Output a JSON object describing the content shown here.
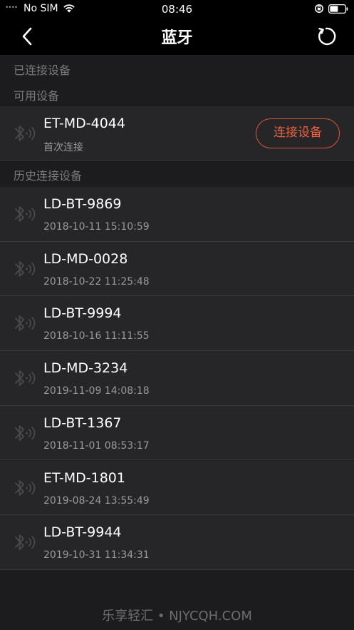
{
  "status_bar": {
    "signal": "••••",
    "carrier": "No SIM",
    "time": "08:46"
  },
  "nav": {
    "title": "蓝牙"
  },
  "sections": {
    "connected": "已连接设备",
    "available": "可用设备",
    "history": "历史连接设备"
  },
  "available_devices": [
    {
      "name": "ET-MD-4044",
      "sub": "首次连接",
      "action": "连接设备"
    }
  ],
  "history_devices": [
    {
      "name": "LD-BT-9869",
      "time": "2018-10-11 15:10:59"
    },
    {
      "name": "LD-MD-0028",
      "time": "2018-10-22 11:25:48"
    },
    {
      "name": "LD-BT-9994",
      "time": "2018-10-16 11:11:55"
    },
    {
      "name": "LD-MD-3234",
      "time": "2019-11-09 14:08:18"
    },
    {
      "name": "LD-BT-1367",
      "time": "2018-11-01 08:53:17"
    },
    {
      "name": "ET-MD-1801",
      "time": "2019-08-24 13:55:49"
    },
    {
      "name": "LD-BT-9944",
      "time": "2019-10-31 11:34:31"
    }
  ],
  "watermark": "乐享轻汇 • NJYCQH.COM",
  "colors": {
    "accent": "#e0523a",
    "row_bg": "#262628",
    "page_bg": "#1c1c1e",
    "bar_bg": "#000000"
  }
}
